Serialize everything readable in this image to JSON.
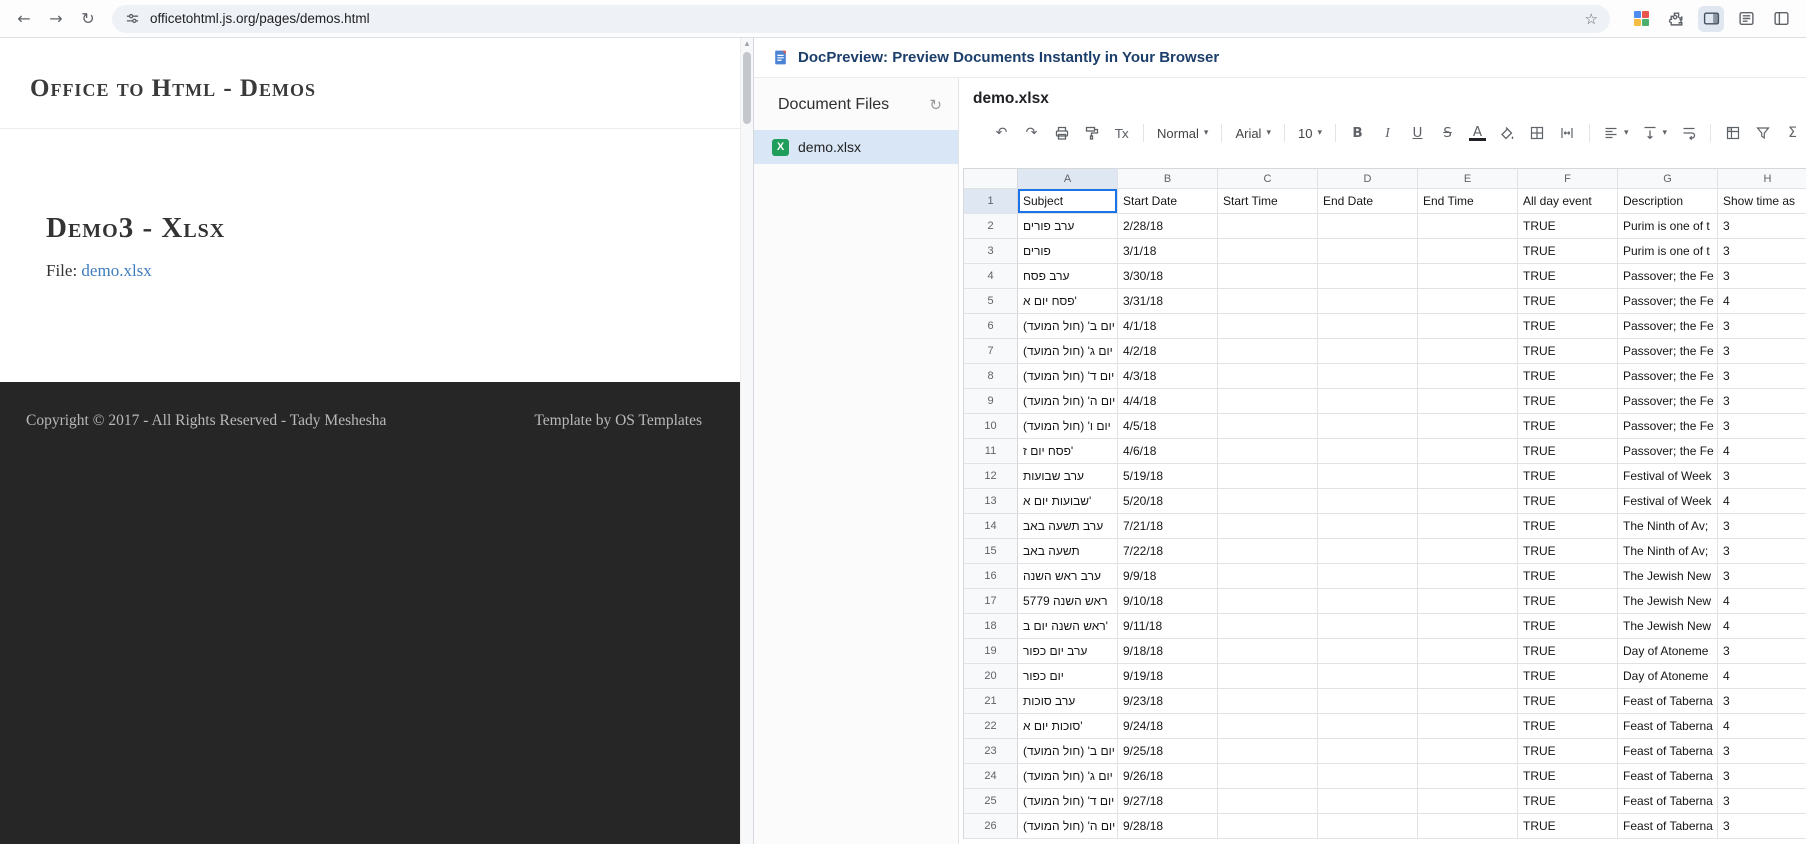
{
  "browser": {
    "url": "officetohtml.js.org/pages/demos.html",
    "icons": {
      "back": "←",
      "forward": "→",
      "reload": "↻",
      "star": "☆",
      "scroll_up": "▴"
    },
    "extension_colors": [
      "#4e8cf0",
      "#e8554d",
      "#f6bc42",
      "#4caf6e"
    ]
  },
  "page": {
    "title": "Office to Html - Demos",
    "demo_title": "Demo3 - Xlsx",
    "file_label": "File:",
    "file_link": "demo.xlsx",
    "footer_left": "Copyright © 2017 - All Rights Reserved - Tady Meshesha",
    "footer_right": "Template by OS Templates"
  },
  "panel": {
    "header_title": "DocPreview: Preview Documents Instantly in Your Browser",
    "sidebar": {
      "title": "Document Files",
      "refresh_glyph": "↻",
      "files": [
        {
          "name": "demo.xlsx",
          "selected": true
        }
      ],
      "file_icon_letter": "X"
    },
    "doc_title": "demo.xlsx",
    "toolbar": {
      "undo": "↶",
      "redo": "↷",
      "clear_format": "Tx",
      "format_dropdown": "Normal",
      "font_dropdown": "Arial",
      "font_size_dropdown": "10",
      "bold": "B",
      "italic": "I",
      "underline": "U",
      "strikethrough": "S",
      "text_color": "A",
      "formula": "Σ",
      "caret": "▾"
    },
    "spreadsheet": {
      "column_letters": [
        "A",
        "B",
        "C",
        "D",
        "E",
        "F",
        "G",
        "H"
      ],
      "selection": {
        "row": 1,
        "col": "A"
      },
      "rows": [
        {
          "n": 1,
          "cells": [
            "Subject",
            "Start Date",
            "Start Time",
            "End Date",
            "End Time",
            "All day event",
            "Description",
            "Show time as"
          ]
        },
        {
          "n": 2,
          "cells": [
            "ערב פורים",
            "2/28/18",
            "",
            "",
            "",
            "TRUE",
            "Purim is one of t",
            "3"
          ]
        },
        {
          "n": 3,
          "cells": [
            "פורים",
            "3/1/18",
            "",
            "",
            "",
            "TRUE",
            "Purim is one of t",
            "3"
          ]
        },
        {
          "n": 4,
          "cells": [
            "ערב פסח",
            "3/30/18",
            "",
            "",
            "",
            "TRUE",
            "Passover; the Fe",
            "3"
          ]
        },
        {
          "n": 5,
          "cells": [
            "פסח יום א'",
            "3/31/18",
            "",
            "",
            "",
            "TRUE",
            "Passover; the Fe",
            "4"
          ]
        },
        {
          "n": 6,
          "cells": [
            "יום ב' (חול המועד)",
            "4/1/18",
            "",
            "",
            "",
            "TRUE",
            "Passover; the Fe",
            "3"
          ]
        },
        {
          "n": 7,
          "cells": [
            "יום ג' (חול המועד)",
            "4/2/18",
            "",
            "",
            "",
            "TRUE",
            "Passover; the Fe",
            "3"
          ]
        },
        {
          "n": 8,
          "cells": [
            "יום ד' (חול המועד)",
            "4/3/18",
            "",
            "",
            "",
            "TRUE",
            "Passover; the Fe",
            "3"
          ]
        },
        {
          "n": 9,
          "cells": [
            "יום ה' (חול המועד)",
            "4/4/18",
            "",
            "",
            "",
            "TRUE",
            "Passover; the Fe",
            "3"
          ]
        },
        {
          "n": 10,
          "cells": [
            "יום ו' (חול המועד)",
            "4/5/18",
            "",
            "",
            "",
            "TRUE",
            "Passover; the Fe",
            "3"
          ]
        },
        {
          "n": 11,
          "cells": [
            "פסח יום ז'",
            "4/6/18",
            "",
            "",
            "",
            "TRUE",
            "Passover; the Fe",
            "4"
          ]
        },
        {
          "n": 12,
          "cells": [
            "ערב שבועות",
            "5/19/18",
            "",
            "",
            "",
            "TRUE",
            "Festival of Week",
            "3"
          ]
        },
        {
          "n": 13,
          "cells": [
            "שבועות יום א'",
            "5/20/18",
            "",
            "",
            "",
            "TRUE",
            "Festival of Week",
            "4"
          ]
        },
        {
          "n": 14,
          "cells": [
            "ערב תשעה באב",
            "7/21/18",
            "",
            "",
            "",
            "TRUE",
            "The Ninth of Av;",
            "3"
          ]
        },
        {
          "n": 15,
          "cells": [
            "תשעה באב",
            "7/22/18",
            "",
            "",
            "",
            "TRUE",
            "The Ninth of Av;",
            "3"
          ]
        },
        {
          "n": 16,
          "cells": [
            "ערב ראש השנה",
            "9/9/18",
            "",
            "",
            "",
            "TRUE",
            "The Jewish New",
            "3"
          ]
        },
        {
          "n": 17,
          "cells": [
            "ראש השנה 5779",
            "9/10/18",
            "",
            "",
            "",
            "TRUE",
            "The Jewish New",
            "4"
          ]
        },
        {
          "n": 18,
          "cells": [
            "ראש השנה יום ב'",
            "9/11/18",
            "",
            "",
            "",
            "TRUE",
            "The Jewish New",
            "4"
          ]
        },
        {
          "n": 19,
          "cells": [
            "ערב יום כפור",
            "9/18/18",
            "",
            "",
            "",
            "TRUE",
            "Day of Atoneme",
            "3"
          ]
        },
        {
          "n": 20,
          "cells": [
            "יום כפור",
            "9/19/18",
            "",
            "",
            "",
            "TRUE",
            "Day of Atoneme",
            "4"
          ]
        },
        {
          "n": 21,
          "cells": [
            "ערב סוכות",
            "9/23/18",
            "",
            "",
            "",
            "TRUE",
            "Feast of Taberna",
            "3"
          ]
        },
        {
          "n": 22,
          "cells": [
            "סוכות יום א'",
            "9/24/18",
            "",
            "",
            "",
            "TRUE",
            "Feast of Taberna",
            "4"
          ]
        },
        {
          "n": 23,
          "cells": [
            "יום ב' (חול המועד)",
            "9/25/18",
            "",
            "",
            "",
            "TRUE",
            "Feast of Taberna",
            "3"
          ]
        },
        {
          "n": 24,
          "cells": [
            "יום ג' (חול המועד)",
            "9/26/18",
            "",
            "",
            "",
            "TRUE",
            "Feast of Taberna",
            "3"
          ]
        },
        {
          "n": 25,
          "cells": [
            "יום ד' (חול המועד)",
            "9/27/18",
            "",
            "",
            "",
            "TRUE",
            "Feast of Taberna",
            "3"
          ]
        },
        {
          "n": 26,
          "cells": [
            "יום ה' (חול המועד)",
            "9/28/18",
            "",
            "",
            "",
            "TRUE",
            "Feast of Taberna",
            "3"
          ]
        }
      ]
    }
  }
}
